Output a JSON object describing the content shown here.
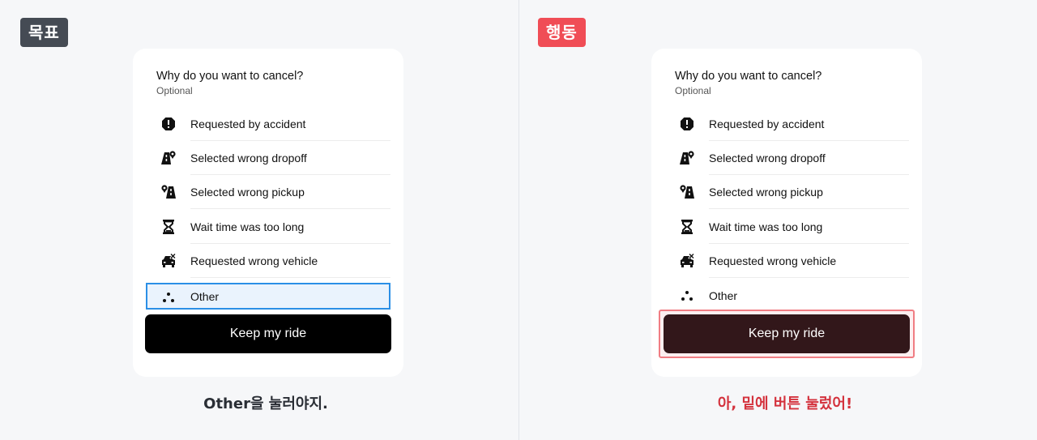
{
  "colors": {
    "goal_tag": "#454b54",
    "action_tag": "#f04d56",
    "highlight_border": "#2b8fe6",
    "press_outline": "#f07d83",
    "action_caption": "#d4323d"
  },
  "goal": {
    "tag": "목표",
    "caption": "Other을 눌러야지."
  },
  "action": {
    "tag": "행동",
    "caption": "아, 밑에 버튼 눌렀어!"
  },
  "card": {
    "title": "Why do you want to cancel?",
    "subtitle": "Optional",
    "options": [
      {
        "label": "Requested by accident",
        "icon": "alert-octagon-icon"
      },
      {
        "label": "Selected wrong dropoff",
        "icon": "road-pin-icon"
      },
      {
        "label": "Selected wrong pickup",
        "icon": "pin-road-icon"
      },
      {
        "label": "Wait time was too long",
        "icon": "hourglass-icon"
      },
      {
        "label": "Requested wrong vehicle",
        "icon": "car-icon"
      },
      {
        "label": "Other",
        "icon": "dots-icon"
      }
    ],
    "button": "Keep my ride"
  }
}
